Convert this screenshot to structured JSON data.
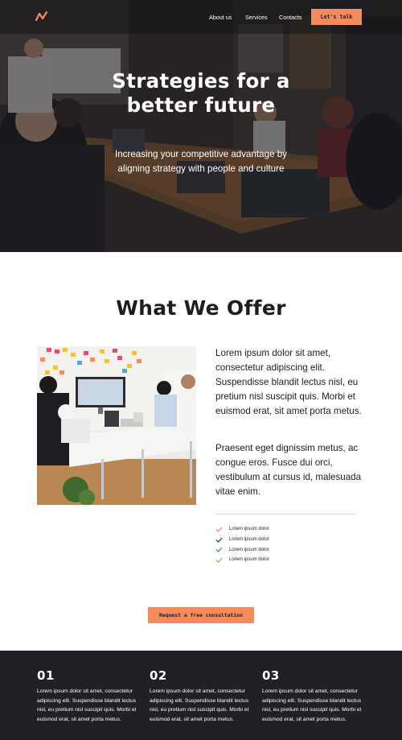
{
  "header": {
    "logo_icon": "zigzag-logo-icon",
    "nav": [
      "About us",
      "Services",
      "Contacts"
    ],
    "cta": "Let's talk"
  },
  "hero": {
    "title_line1": "Strategies for a",
    "title_line2": "better future",
    "subtitle_line1": "Increasing your competitive advantage by",
    "subtitle_line2": "aligning strategy with people and culture"
  },
  "offer": {
    "title": "What We Offer",
    "paragraph1": "Lorem ipsum dolor sit amet, consectetur adipiscing elit. Suspendisse blandit lectus nisl, eu pretium nisl suscipit quis. Morbi et euismod erat, sit amet porta metus.",
    "paragraph2": "Praesent eget dignissim metus, ac congue eros. Fusce dui orci, vestibulum at cursus id, malesuada vitae enim.",
    "checklist": [
      {
        "label": "Lorem ipsum dolor",
        "color": "#f58a5c"
      },
      {
        "label": "Lorem ipsum dolor",
        "color": "#2b3a67"
      },
      {
        "label": "Lorem ipsum dolor",
        "color": "#3a9a8c"
      },
      {
        "label": "Lorem ipsum dolor",
        "color": "#9ab84a"
      }
    ],
    "cta": "Request a free consultation"
  },
  "features": [
    {
      "number": "01",
      "text": "Lorem ipsum dolor sit amet, consectetur adipiscing elit. Suspendisse blandit lectus nisl, eu pretium nisl suscipit quis. Morbi et euismod erat, sit amet porta metus."
    },
    {
      "number": "02",
      "text": "Lorem ipsum dolor sit amet, consectetur adipiscing elit. Suspendisse blandit lectus nisl, eu pretium nisl suscipit quis. Morbi et euismod erat, sit amet porta metus."
    },
    {
      "number": "03",
      "text": "Lorem ipsum dolor sit amet, consectetur adipiscing elit. Suspendisse blandit lectus nisl, eu pretium nisl suscipit quis. Morbi et euismod erat, sit amet porta metus."
    }
  ],
  "colors": {
    "accent": "#f58a5c",
    "dark": "#202126",
    "text": "#1e1e22"
  }
}
